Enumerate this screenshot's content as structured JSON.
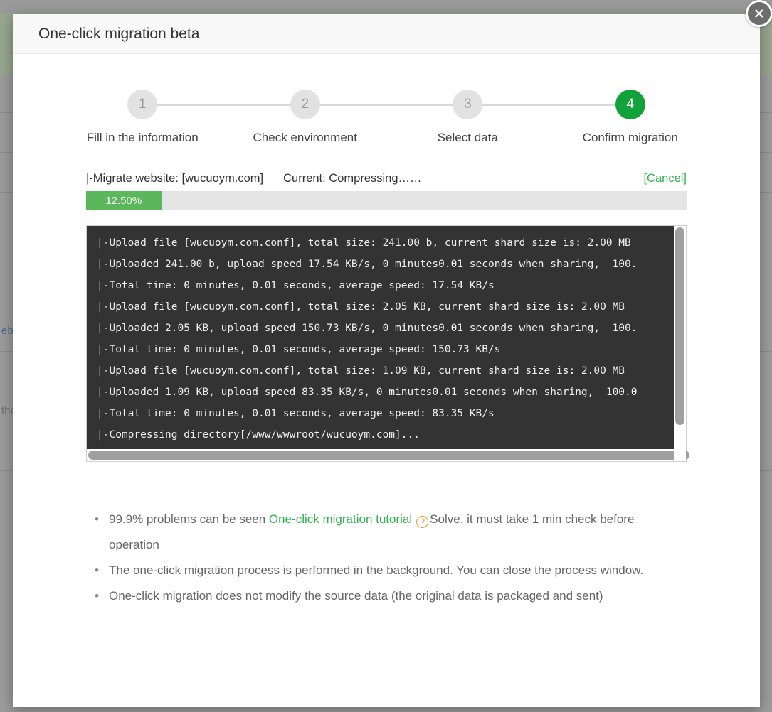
{
  "backdrop": {
    "rows": [
      {
        "text": ""
      },
      {
        "text": ""
      },
      {
        "text": ""
      },
      {
        "text": ""
      },
      {
        "text": "eb",
        "link": true
      },
      {
        "text": ""
      },
      {
        "text": "tho"
      },
      {
        "text": ""
      }
    ]
  },
  "modal": {
    "title": "One-click migration beta",
    "close_icon": "close-icon"
  },
  "steps": [
    {
      "number": "1",
      "label": "Fill in the information",
      "active": false
    },
    {
      "number": "2",
      "label": "Check environment",
      "active": false
    },
    {
      "number": "3",
      "label": "Select data",
      "active": false
    },
    {
      "number": "4",
      "label": "Confirm migration",
      "active": true
    }
  ],
  "progress": {
    "site_text": "|-Migrate website: [wucuoym.com]",
    "current_text": "Current: Compressing……",
    "cancel_label": "[Cancel]",
    "percent_label": "12.50%",
    "percent_value": 12.5
  },
  "console": {
    "lines": [
      "|-Upload file [wucuoym.com.conf], total size: 241.00 b, current shard size is: 2.00 MB",
      "|-Uploaded 241.00 b, upload speed 17.54 KB/s, 0 minutes0.01 seconds when sharing,  100.",
      "|-Total time: 0 minutes, 0.01 seconds, average speed: 17.54 KB/s",
      "|-Upload file [wucuoym.com.conf], total size: 2.05 KB, current shard size is: 2.00 MB",
      "|-Uploaded 2.05 KB, upload speed 150.73 KB/s, 0 minutes0.01 seconds when sharing,  100.",
      "|-Total time: 0 minutes, 0.01 seconds, average speed: 150.73 KB/s",
      "|-Upload file [wucuoym.com.conf], total size: 1.09 KB, current shard size is: 2.00 MB",
      "|-Uploaded 1.09 KB, upload speed 83.35 KB/s, 0 minutes0.01 seconds when sharing,  100.0",
      "|-Total time: 0 minutes, 0.01 seconds, average speed: 83.35 KB/s",
      "|-Compressing directory[/www/wwwroot/wucuoym.com]..."
    ]
  },
  "notes": {
    "note1_before": "99.9% problems can be seen ",
    "note1_link": "One-click migration tutorial",
    "note1_help_icon": "question-mark-icon",
    "note1_after": "Solve, it must take 1 min check before operation",
    "note2": "The one-click migration process is performed in the background. You can close the process window.",
    "note3": "One-click migration does not modify the source data (the original data is packaged and sent)"
  },
  "colors": {
    "accent_green": "#13a13c",
    "progress_green": "#5bb75b",
    "link_green": "#2eb34a",
    "help_orange": "#f0932b",
    "console_bg": "#333333",
    "step_inactive": "#e2e2e2"
  }
}
